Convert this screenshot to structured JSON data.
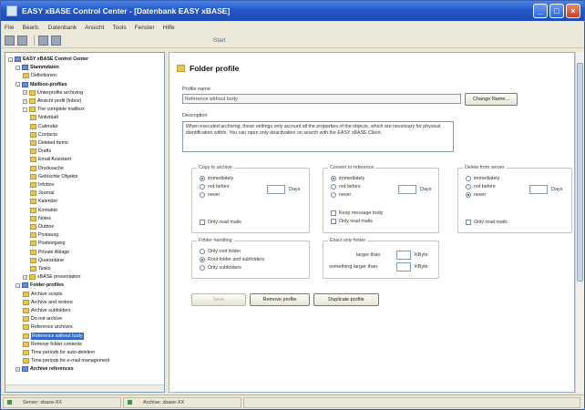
{
  "window": {
    "title": "EASY xBASE Control Center - [Datenbank EASY xBASE]"
  },
  "menu": [
    "File",
    "Bearb.",
    "Datenbank",
    "Ansicht",
    "Tools",
    "Fenster",
    "Hilfe"
  ],
  "toolbar": {
    "right_text": "Start"
  },
  "tree": {
    "items": [
      {
        "label": "EASY xBASE Control Center",
        "indent": 0,
        "icon": "blue",
        "exp": "-",
        "bold": true
      },
      {
        "label": "Stammdaten",
        "indent": 1,
        "icon": "blue",
        "exp": "-",
        "bold": true
      },
      {
        "label": "Definitionen",
        "indent": 2,
        "icon": "yellow"
      },
      {
        "label": "Mailbox-profiles",
        "indent": 1,
        "icon": "blue",
        "exp": "-",
        "bold": true
      },
      {
        "label": "Unterprofile archiving",
        "indent": 2,
        "icon": "yellow",
        "exp": "+"
      },
      {
        "label": "Ansicht profil (Inbox)",
        "indent": 2,
        "icon": "yellow",
        "exp": "+"
      },
      {
        "label": "The complete mailbox",
        "indent": 2,
        "icon": "yellow",
        "exp": "-"
      },
      {
        "label": "Notizblatt",
        "indent": 3,
        "icon": "yellow"
      },
      {
        "label": "Calendar",
        "indent": 3,
        "icon": "yellow"
      },
      {
        "label": "Contacts",
        "indent": 3,
        "icon": "yellow"
      },
      {
        "label": "Deleted Items",
        "indent": 3,
        "icon": "yellow"
      },
      {
        "label": "Drafts",
        "indent": 3,
        "icon": "yellow"
      },
      {
        "label": "Email Assistant",
        "indent": 3,
        "icon": "yellow"
      },
      {
        "label": "Drucksuche",
        "indent": 3,
        "icon": "yellow"
      },
      {
        "label": "Gelöschte Objekte",
        "indent": 3,
        "icon": "yellow"
      },
      {
        "label": "Infobox",
        "indent": 3,
        "icon": "yellow"
      },
      {
        "label": "Journal",
        "indent": 3,
        "icon": "yellow"
      },
      {
        "label": "Kalender",
        "indent": 3,
        "icon": "yellow"
      },
      {
        "label": "Kontakte",
        "indent": 3,
        "icon": "yellow"
      },
      {
        "label": "Notes",
        "indent": 3,
        "icon": "yellow"
      },
      {
        "label": "Outbox",
        "indent": 3,
        "icon": "yellow"
      },
      {
        "label": "Postausg.",
        "indent": 3,
        "icon": "yellow"
      },
      {
        "label": "Posteingang",
        "indent": 3,
        "icon": "yellow"
      },
      {
        "label": "Private Ablage",
        "indent": 3,
        "icon": "yellow"
      },
      {
        "label": "Quarantäne",
        "indent": 3,
        "icon": "yellow"
      },
      {
        "label": "Tasks",
        "indent": 3,
        "icon": "yellow"
      },
      {
        "label": "xBASE presentation",
        "indent": 2,
        "icon": "yellow",
        "exp": "+"
      },
      {
        "label": "Folder-profiles",
        "indent": 1,
        "icon": "blue",
        "exp": "-",
        "bold": true
      },
      {
        "label": "Archive scripts",
        "indent": 2,
        "icon": "yellow"
      },
      {
        "label": "Archive and restore",
        "indent": 2,
        "icon": "yellow"
      },
      {
        "label": "Archive subfolders",
        "indent": 2,
        "icon": "yellow"
      },
      {
        "label": "Do not archive",
        "indent": 2,
        "icon": "yellow"
      },
      {
        "label": "Reference archives",
        "indent": 2,
        "icon": "yellow"
      },
      {
        "label": "Reference without body",
        "indent": 2,
        "icon": "yellow",
        "selected": true
      },
      {
        "label": "Remove folder contents",
        "indent": 2,
        "icon": "yellow"
      },
      {
        "label": "Time periods for auto-deletion",
        "indent": 2,
        "icon": "yellow"
      },
      {
        "label": "Time periods for e-mail management",
        "indent": 2,
        "icon": "yellow"
      },
      {
        "label": "Archive references",
        "indent": 1,
        "icon": "blue",
        "exp": "+",
        "bold": true
      }
    ]
  },
  "main": {
    "heading": "Folder profile",
    "profile_name_label": "Profile name",
    "profile_name_value": "Reference without body",
    "change_name_button": "Change Name...",
    "description_label": "Description",
    "description_text": "When executed archiving, these settings only account all the properties of the objects, which are necessary for physical identification within. You can open only deactivation on search with the EASY xBASE Client.",
    "copy_group": {
      "title": "Copy to archive",
      "options": [
        "immediately",
        "not before",
        "never"
      ],
      "selected": 0,
      "days_label": "Days",
      "check_label": "Only read mails"
    },
    "reference_group": {
      "title": "Convert to reference",
      "options": [
        "immediately",
        "not before",
        "never"
      ],
      "selected": 0,
      "days_label": "Days",
      "check1": "Keep message body",
      "check2": "Only read mails"
    },
    "delete_group": {
      "title": "Delete from server",
      "options": [
        "immediately",
        "not before",
        "never"
      ],
      "selected": 2,
      "days_label": "Days",
      "check_label": "Only read mails"
    },
    "folder_group": {
      "title": "Folder handling",
      "options": [
        "Only root folder",
        "Root folder and subfolders",
        "Only subfolders"
      ],
      "selected": 1
    },
    "size_group": {
      "title": "Exact only folder",
      "larger_label": "larger than",
      "larger_unit": "KByte",
      "smaller_label": "something larger than",
      "smaller_unit": "KByte"
    },
    "buttons": {
      "save": "Save",
      "remove": "Remove profile",
      "duplicate": "Duplicate profile"
    }
  },
  "status": {
    "cell1": "Server: xbase-XX",
    "cell2": "Archive: xbase-XX"
  },
  "colors": {
    "titlebar": "#2458c6",
    "selection": "#316ac5",
    "status_ok": "#3a9a3a"
  }
}
